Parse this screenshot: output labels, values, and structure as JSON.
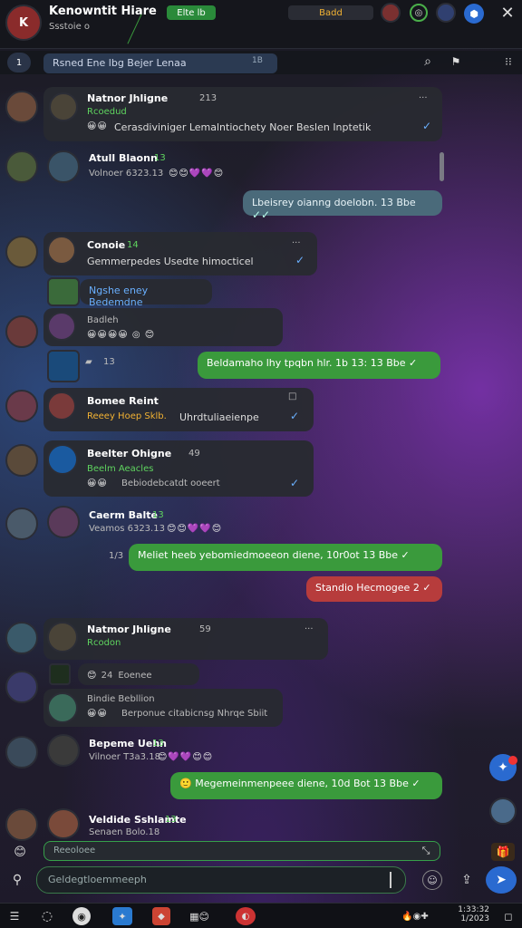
{
  "header": {
    "title": "Kenowntit Hiare",
    "subtitle": "Ssstoie o",
    "status_chip": "Elte lb",
    "counter": "Badd",
    "top_avatar_letter": "K"
  },
  "filter": {
    "badge": "1",
    "search_placeholder": "Rsned  Ene lbg Bejer Lenaa",
    "tag": "1B"
  },
  "messages": [
    {
      "name": "Natnor Jhligne",
      "time": "213",
      "sub": "Rcoedud",
      "text": "Cerasdiviniger Lemalntiochety Noer Beslen Inptetik",
      "menu": "..."
    },
    {
      "name": "Atull Blaonn",
      "time": "13",
      "text": "Volnoer 6323.13"
    },
    {
      "text": "Lbeisrey oianng doelobn. 13 Bbe"
    },
    {
      "name": "Conoie",
      "time": "14",
      "text": "Gemmerpedes  Usedte himocticel",
      "menu": "..."
    },
    {
      "text": "Ngshe eney Bedemdne"
    },
    {
      "name": "Badleh",
      "text": "OBh"
    },
    {
      "time": "13",
      "text": "Beldamaho lhy tpqbn hlr. 1b 13: 13 Bbe"
    },
    {
      "name": "Bomee Reint",
      "text": "Uhrdtuliaeienpe",
      "sub": "Reeey  Hoep Sklb.",
      "menu": "□"
    },
    {
      "name": "Beelter Ohigne",
      "time": "49",
      "sub": "Beelm Aeacles",
      "text": "Bebiodebcatdt ooeert"
    },
    {
      "name": "Caerm Balte",
      "time": "13",
      "text": "Veamos 6323.13"
    },
    {
      "lead": "1/3",
      "text": "Meliet heeb yebomiedmoeeon diene, 10r0ot 13 Bbe"
    },
    {
      "text": "Standio Hecmogee 2"
    },
    {
      "name": "Natmor Jhligne",
      "time": "59",
      "sub": "Rcodon",
      "menu": "..."
    },
    {
      "time": "24",
      "text": "Eoenee"
    },
    {
      "name": "Bindie Bebllion",
      "text": "Berponue citabicnsg Nhrqe Sbiit"
    },
    {
      "name": "Bepeme Uehn",
      "time": "13",
      "text": "Vilnoer T3a3.18"
    },
    {
      "text": "Megemeinmenpeee diene, 10d Bot 13 Bbe"
    },
    {
      "name": "Veldide Sshlamte",
      "time": "13",
      "text": "Senaen Bolo.18"
    }
  ],
  "composer": {
    "mini_placeholder": "Reeoloee",
    "main_placeholder": "Geldegtloemmeeph"
  },
  "taskbar": {
    "clock_time": "1:33:32",
    "clock_date": "1/2023"
  },
  "colors": {
    "accent": "#3a9a3c",
    "bubble": "#2b2d33",
    "link": "#6ab0ff",
    "red": "#b73c3c"
  }
}
